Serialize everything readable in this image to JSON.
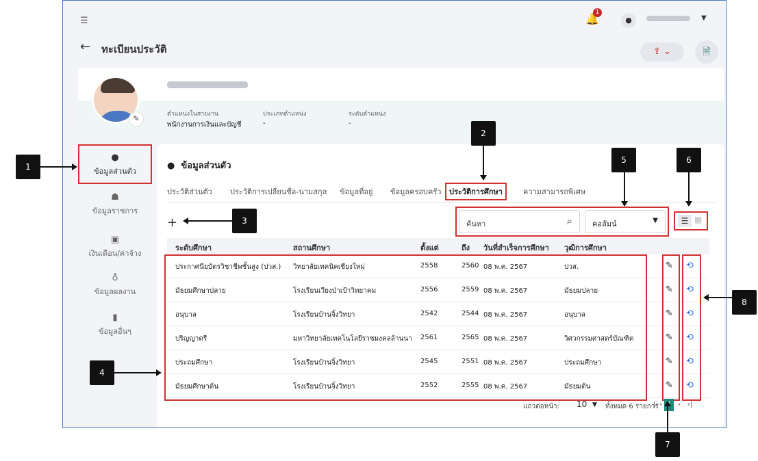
{
  "header": {
    "menu_icon": "menu-collapse-icon",
    "notification_count": "1",
    "user_icon": "person-icon",
    "page_title": "ทะเบียนประวัติ"
  },
  "profile": {
    "position_label": "ตำแหน่งในสายงาน",
    "position_value": "พนักงานการเงินและบัญชี",
    "type_label": "ประเภทตำแหน่ง",
    "type_value": "-",
    "level_label": "ระดับตำแหน่ง",
    "level_value": "-"
  },
  "sidebar": {
    "items": [
      {
        "label": "ข้อมูลส่วนตัว",
        "icon": "person-icon"
      },
      {
        "label": "ข้อมูลราชการ",
        "icon": "people-icon"
      },
      {
        "label": "เงินเดือน/ค่าจ้าง",
        "icon": "money-icon"
      },
      {
        "label": "ข้อมูลผลงาน",
        "icon": "medal-icon"
      },
      {
        "label": "ข้อมูลอื่นๆ",
        "icon": "bookmark-icon"
      }
    ]
  },
  "section": {
    "title": "ข้อมูลส่วนตัว"
  },
  "tabs": [
    {
      "label": "ประวัติส่วนตัว"
    },
    {
      "label": "ประวัติการเปลี่ยนชื่อ-นามสกุล"
    },
    {
      "label": "ข้อมูลที่อยู่"
    },
    {
      "label": "ข้อมูลครอบครัว"
    },
    {
      "label": "ประวัติการศึกษา"
    },
    {
      "label": "ความสามารถพิเศษ"
    }
  ],
  "toolbar": {
    "add_label": "+",
    "search_placeholder": "ค้นหา",
    "column_select": "คอลัมน์"
  },
  "table": {
    "headers": [
      "ระดับศึกษา",
      "สถานศึกษา",
      "ตั้งแต่",
      "ถึง",
      "วันที่สำเร็จการศึกษา",
      "วุฒิการศึกษา"
    ],
    "rows": [
      [
        "ประกาศนียบัตรวิชาชีพชั้นสูง (ปวส.)",
        "วิทยาลัยเทคนิคเชียงใหม่",
        "2558",
        "2560",
        "08 พ.ค. 2567",
        "ปวส."
      ],
      [
        "มัธยมศึกษาปลาย",
        "โรงเรียนเวียงป่าเป้าวิทยาคม",
        "2556",
        "2559",
        "08 พ.ค. 2567",
        "มัธยมปลาย"
      ],
      [
        "อนุบาล",
        "โรงเรียนบ้านจิ้งวิทยา",
        "2542",
        "2544",
        "08 พ.ค. 2567",
        "อนุบาล"
      ],
      [
        "ปริญญาตรี",
        "มหาวิทยาลัยเทคโนโลยีราชมงคลล้านนา",
        "2561",
        "2565",
        "08 พ.ค. 2567",
        "วิศวกรรมศาสตร์บัณฑิต"
      ],
      [
        "ประถมศึกษา",
        "โรงเรียนบ้านจิ้งวิทยา",
        "2545",
        "2551",
        "08 พ.ค. 2567",
        "ประถมศึกษา"
      ],
      [
        "มัธยมศึกษาต้น",
        "โรงเรียนบ้านจิ้งวิทยา",
        "2552",
        "2555",
        "08 พ.ค. 2567",
        "มัธยมต้น"
      ]
    ]
  },
  "pagination": {
    "rows_per_page_label": "แถวต่อหน้า:",
    "rows_per_page": "10",
    "total_label": "ทั้งหมด 6 รายการ",
    "current_page": "1"
  },
  "callouts": [
    "1",
    "2",
    "3",
    "4",
    "5",
    "6",
    "7",
    "8"
  ]
}
